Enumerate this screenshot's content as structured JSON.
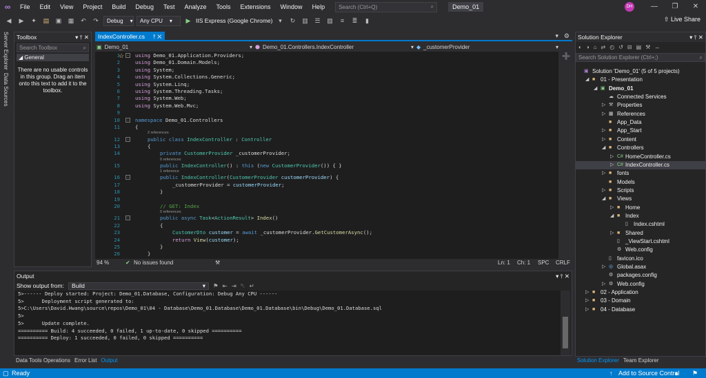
{
  "menu": {
    "items": [
      "File",
      "Edit",
      "View",
      "Project",
      "Build",
      "Debug",
      "Test",
      "Analyze",
      "Tools",
      "Extensions",
      "Window",
      "Help"
    ],
    "search_placeholder": "Search (Ctrl+Q)",
    "solution_name": "Demo_01",
    "avatar_initials": "DH"
  },
  "toolbar": {
    "config": "Debug",
    "platform": "Any CPU",
    "run_target": "IIS Express (Google Chrome)",
    "live_share": "Live Share"
  },
  "left_strip": {
    "server_explorer": "Server Explorer",
    "data_sources": "Data Sources"
  },
  "toolbox": {
    "title": "Toolbox",
    "search_placeholder": "Search Toolbox",
    "group": "General",
    "message": "There are no usable controls in this group. Drag an item onto this text to add it to the toolbox."
  },
  "editor": {
    "tab": "IndexController.cs",
    "nav_project": "Demo_01",
    "nav_class": "Demo_01.Controllers.IndexController",
    "nav_member": "_customerProvider",
    "refs": {
      "two": "2 references",
      "zero": "0 references",
      "one": "1 reference"
    },
    "code": {
      "l1_using": "using",
      "l1_ns": "Demo_01.Application.Providers;",
      "l2_using": "using",
      "l2_ns": "Demo_01.Domain.Models;",
      "l3_using": "using",
      "l3_ns": "System;",
      "l4_using": "using",
      "l4_ns": "System.Collections.Generic;",
      "l5_using": "using",
      "l5_ns": "System.Linq;",
      "l6_using": "using",
      "l6_ns": "System.Threading.Tasks;",
      "l7_using": "using",
      "l7_ns": "System.Web;",
      "l8_using": "using",
      "l8_ns": "System.Web.Mvc;",
      "l10_ns_kw": "namespace",
      "l10_name": "Demo_01.Controllers",
      "l11": "{",
      "l12_kw": "public class",
      "l12_name": "IndexController",
      "l12_colon": " : ",
      "l12_base": "Controller",
      "l13": "{",
      "l14_kw": "private",
      "l14_type": "CustomerProvider",
      "l14_field": " _customerProvider;",
      "l15_kw": "public",
      "l15_name": "IndexController",
      "l15_rest1": "() : ",
      "l15_this": "this",
      "l15_rest2": " (",
      "l15_new": "new",
      "l15_type": "CustomerProvider",
      "l15_rest3": "()) { }",
      "l16_kw": "public",
      "l16_name": "IndexController",
      "l16_paren": "(",
      "l16_type": "CustomerProvider",
      "l16_param": "customerProvider",
      "l16_end": ") {",
      "l17_field": "_customerProvider = ",
      "l17_param": "customerProvider",
      "l17_end": ";",
      "l18": "}",
      "l20": "// GET: Index",
      "l21_kw": "public async",
      "l21_task": "Task",
      "l21_lt": "<",
      "l21_ar": "ActionResult",
      "l21_gt": "> ",
      "l21_name": "Index",
      "l21_end": "()",
      "l22": "{",
      "l23_type": "CustomerDto",
      "l23_var": "customer",
      "l23_eq": " = ",
      "l23_await": "await",
      "l23_call": " _customerProvider.",
      "l23_fn": "GetCustomerAsync",
      "l23_end": "();",
      "l24_kw": "return",
      "l24_fn": "View",
      "l24_p1": "(",
      "l24_var": "customer",
      "l24_end": ");",
      "l25": "}",
      "l26": "}",
      "l27": "}"
    },
    "zoom": "94 %",
    "issues": "No issues found",
    "ln": "Ln: 1",
    "ch": "Ch: 1",
    "spc": "SPC",
    "crlf": "CRLF"
  },
  "output": {
    "title": "Output",
    "show_from_label": "Show output from:",
    "show_from_value": "Build",
    "lines": [
      "5>------ Deploy started: Project: Demo_01.Database, Configuration: Debug Any CPU ------",
      "5>      Deployment script generated to:",
      "5>C:\\Users\\David.Hwang\\source\\repos\\Demo_01\\04 - Database\\Demo_01.Database\\Demo_01.Database\\bin\\Debug\\Demo_01.Database.sql",
      "5>",
      "5>      Update complete.",
      "========== Build: 4 succeeded, 0 failed, 1 up-to-date, 0 skipped ==========",
      "========== Deploy: 1 succeeded, 0 failed, 0 skipped =========="
    ]
  },
  "bottom_tabs": [
    "Data Tools Operations",
    "Error List",
    "Output"
  ],
  "solution_explorer": {
    "title": "Solution Explorer",
    "search_placeholder": "Search Solution Explorer (Ctrl+;)",
    "items": [
      {
        "label": "Solution 'Demo_01' (5 of 5 projects)",
        "indent": 0,
        "arrow": "",
        "icon": "solution"
      },
      {
        "label": "01 - Presentation",
        "indent": 1,
        "arrow": "open",
        "icon": "folder"
      },
      {
        "label": "Demo_01",
        "indent": 2,
        "arrow": "open",
        "icon": "project"
      },
      {
        "label": "Connected Services",
        "indent": 3,
        "arrow": "",
        "icon": "service"
      },
      {
        "label": "Properties",
        "indent": 3,
        "arrow": "closed",
        "icon": "wrench"
      },
      {
        "label": "References",
        "indent": 3,
        "arrow": "closed",
        "icon": "refs"
      },
      {
        "label": "App_Data",
        "indent": 3,
        "arrow": "",
        "icon": "folder"
      },
      {
        "label": "App_Start",
        "indent": 3,
        "arrow": "closed",
        "icon": "folder"
      },
      {
        "label": "Content",
        "indent": 3,
        "arrow": "closed",
        "icon": "folder"
      },
      {
        "label": "Controllers",
        "indent": 3,
        "arrow": "open",
        "icon": "folder"
      },
      {
        "label": "HomeController.cs",
        "indent": 4,
        "arrow": "closed",
        "icon": "cs"
      },
      {
        "label": "IndexController.cs",
        "indent": 4,
        "arrow": "closed",
        "icon": "cs"
      },
      {
        "label": "fonts",
        "indent": 3,
        "arrow": "closed",
        "icon": "folder"
      },
      {
        "label": "Models",
        "indent": 3,
        "arrow": "",
        "icon": "folder"
      },
      {
        "label": "Scripts",
        "indent": 3,
        "arrow": "closed",
        "icon": "folder"
      },
      {
        "label": "Views",
        "indent": 3,
        "arrow": "open",
        "icon": "folder"
      },
      {
        "label": "Home",
        "indent": 4,
        "arrow": "closed",
        "icon": "folder"
      },
      {
        "label": "Index",
        "indent": 4,
        "arrow": "open",
        "icon": "folder"
      },
      {
        "label": "Index.cshtml",
        "indent": 5,
        "arrow": "",
        "icon": "file"
      },
      {
        "label": "Shared",
        "indent": 4,
        "arrow": "closed",
        "icon": "folder"
      },
      {
        "label": "_ViewStart.cshtml",
        "indent": 4,
        "arrow": "",
        "icon": "file"
      },
      {
        "label": "Web.config",
        "indent": 4,
        "arrow": "",
        "icon": "config"
      },
      {
        "label": "favicon.ico",
        "indent": 3,
        "arrow": "",
        "icon": "file"
      },
      {
        "label": "Global.asax",
        "indent": 3,
        "arrow": "closed",
        "icon": "globe"
      },
      {
        "label": "packages.config",
        "indent": 3,
        "arrow": "",
        "icon": "config"
      },
      {
        "label": "Web.config",
        "indent": 3,
        "arrow": "closed",
        "icon": "config"
      },
      {
        "label": "02 - Application",
        "indent": 1,
        "arrow": "closed",
        "icon": "folder"
      },
      {
        "label": "03 - Domain",
        "indent": 1,
        "arrow": "closed",
        "icon": "folder"
      },
      {
        "label": "04 - Database",
        "indent": 1,
        "arrow": "closed",
        "icon": "folder"
      }
    ],
    "tabs": [
      "Solution Explorer",
      "Team Explorer"
    ]
  },
  "statusbar": {
    "status": "Ready",
    "source_control": "Add to Source Control"
  }
}
